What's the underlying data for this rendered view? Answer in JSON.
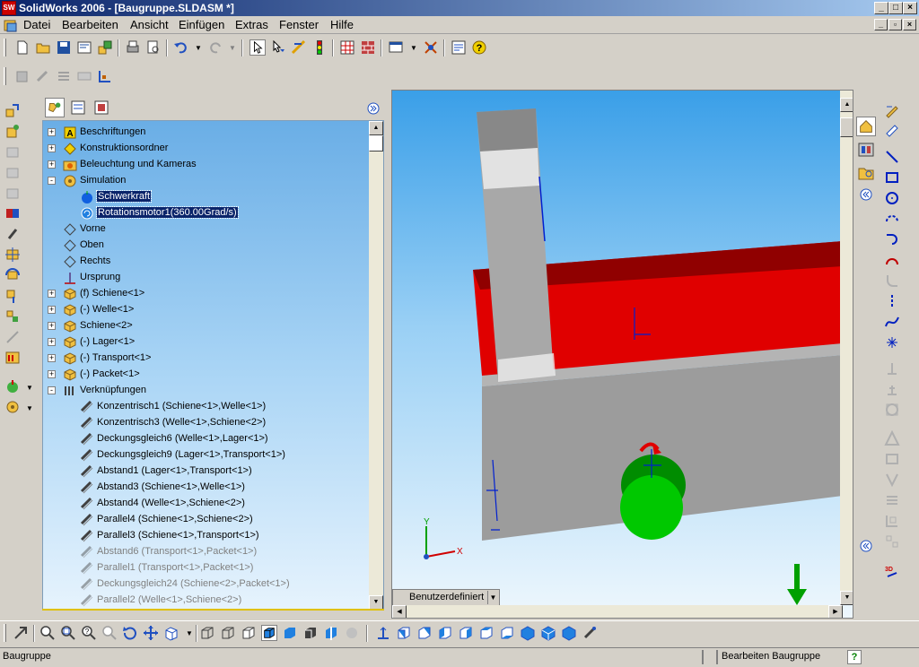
{
  "window": {
    "title": "SolidWorks 2006 - [Baugruppe.SLDASM *]",
    "app_icon_text": "SW"
  },
  "menu": {
    "items": [
      "Datei",
      "Bearbeiten",
      "Ansicht",
      "Einfügen",
      "Extras",
      "Fenster",
      "Hilfe"
    ]
  },
  "tree": {
    "items": [
      {
        "label": "Beschriftungen",
        "icon": "annotations-icon",
        "expander": "+",
        "level": 0
      },
      {
        "label": "Konstruktionsordner",
        "icon": "design-binder-icon",
        "expander": "+",
        "level": 0
      },
      {
        "label": "Beleuchtung und Kameras",
        "icon": "lights-cameras-icon",
        "expander": "+",
        "level": 0
      },
      {
        "label": "Simulation",
        "icon": "simulation-icon",
        "expander": "-",
        "level": 0
      },
      {
        "label": "Schwerkraft",
        "icon": "gravity-icon",
        "expander": "",
        "level": 1,
        "selected": true
      },
      {
        "label": "Rotationsmotor1(360.00Grad/s)",
        "icon": "rotary-motor-icon",
        "expander": "",
        "level": 1,
        "selected": true
      },
      {
        "label": "Vorne",
        "icon": "plane-icon",
        "expander": "",
        "level": 0
      },
      {
        "label": "Oben",
        "icon": "plane-icon",
        "expander": "",
        "level": 0
      },
      {
        "label": "Rechts",
        "icon": "plane-icon",
        "expander": "",
        "level": 0
      },
      {
        "label": "Ursprung",
        "icon": "origin-icon",
        "expander": "",
        "level": 0
      },
      {
        "label": "(f) Schiene<1>",
        "icon": "part-icon",
        "expander": "+",
        "level": 0
      },
      {
        "label": "(-) Welle<1>",
        "icon": "part-icon",
        "expander": "+",
        "level": 0
      },
      {
        "label": "Schiene<2>",
        "icon": "part-icon",
        "expander": "+",
        "level": 0
      },
      {
        "label": "(-) Lager<1>",
        "icon": "part-icon",
        "expander": "+",
        "level": 0
      },
      {
        "label": "(-) Transport<1>",
        "icon": "part-icon",
        "expander": "+",
        "level": 0
      },
      {
        "label": "(-) Packet<1>",
        "icon": "part-icon",
        "expander": "+",
        "level": 0
      },
      {
        "label": "Verknüpfungen",
        "icon": "mates-folder-icon",
        "expander": "-",
        "level": 0
      },
      {
        "label": "Konzentrisch1 (Schiene<1>,Welle<1>)",
        "icon": "mate-icon",
        "expander": "",
        "level": 1
      },
      {
        "label": "Konzentrisch3 (Welle<1>,Schiene<2>)",
        "icon": "mate-icon",
        "expander": "",
        "level": 1
      },
      {
        "label": "Deckungsgleich6 (Welle<1>,Lager<1>)",
        "icon": "mate-icon",
        "expander": "",
        "level": 1
      },
      {
        "label": "Deckungsgleich9 (Lager<1>,Transport<1>)",
        "icon": "mate-icon",
        "expander": "",
        "level": 1
      },
      {
        "label": "Abstand1 (Lager<1>,Transport<1>)",
        "icon": "mate-icon",
        "expander": "",
        "level": 1
      },
      {
        "label": "Abstand3 (Schiene<1>,Welle<1>)",
        "icon": "mate-icon",
        "expander": "",
        "level": 1
      },
      {
        "label": "Abstand4 (Welle<1>,Schiene<2>)",
        "icon": "mate-icon",
        "expander": "",
        "level": 1
      },
      {
        "label": "Parallel4 (Schiene<1>,Schiene<2>)",
        "icon": "mate-icon",
        "expander": "",
        "level": 1
      },
      {
        "label": "Parallel3 (Schiene<1>,Transport<1>)",
        "icon": "mate-icon",
        "expander": "",
        "level": 1
      },
      {
        "label": "Abstand6 (Transport<1>,Packet<1>)",
        "icon": "mate-icon",
        "expander": "",
        "level": 1,
        "dim": true
      },
      {
        "label": "Parallel1 (Transport<1>,Packet<1>)",
        "icon": "mate-icon",
        "expander": "",
        "level": 1,
        "dim": true
      },
      {
        "label": "Deckungsgleich24 (Schiene<2>,Packet<1>)",
        "icon": "mate-icon",
        "expander": "",
        "level": 1,
        "dim": true
      },
      {
        "label": "Parallel2 (Welle<1>,Schiene<2>)",
        "icon": "mate-icon",
        "expander": "",
        "level": 1,
        "dim": true
      }
    ]
  },
  "viewport": {
    "view_dropdown": "Benutzerdefiniert",
    "triad": {
      "x": "X",
      "y": "Y"
    }
  },
  "status": {
    "left": "Baugruppe",
    "mode": "Bearbeiten Baugruppe",
    "help": "?"
  },
  "colors": {
    "selection": "#0a246a",
    "part_red": "#e00000",
    "part_gray": "#a8a8a8",
    "motor_green": "#00c800",
    "title_start": "#0a246a"
  }
}
